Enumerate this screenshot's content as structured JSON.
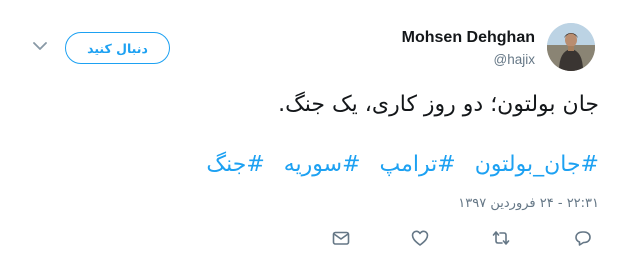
{
  "author": {
    "display_name": "Mohsen Dehghan",
    "handle": "@hajix"
  },
  "follow_button": {
    "label": "دنبال کنید"
  },
  "tweet": {
    "text": "جان بولتون؛ دو روز کاری، یک جنگ.",
    "hashtags": [
      "#جان_بولتون",
      "#ترامپ",
      "#سوریه",
      "#جنگ"
    ],
    "timestamp": "۲۲:۳۱ - ۲۴ فروردین ۱۳۹۷"
  },
  "icons": {
    "menu": "chevron-down-icon",
    "reply": "reply-icon",
    "retweet": "retweet-icon",
    "like": "heart-icon",
    "dm": "envelope-icon"
  },
  "colors": {
    "accent": "#1da1f2",
    "secondary_text": "#657786",
    "primary_text": "#14171a",
    "icon_gray": "#657786"
  }
}
